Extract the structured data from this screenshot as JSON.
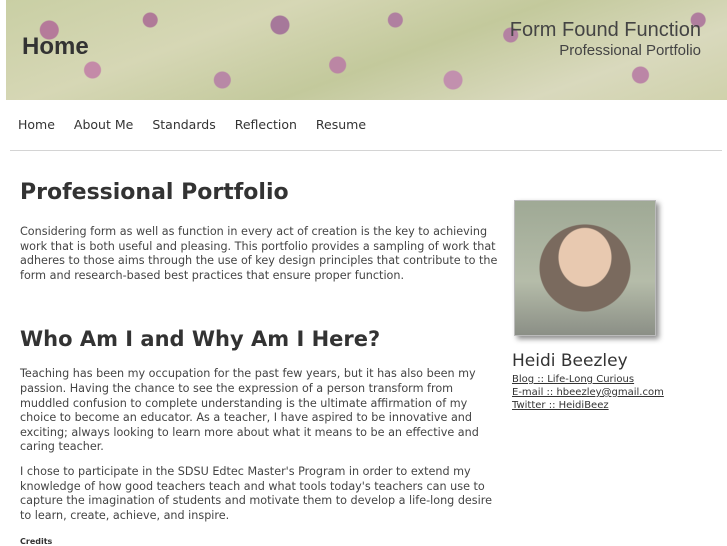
{
  "header": {
    "title": "Home",
    "site_title": "Form Found Function",
    "site_subtitle": "Professional Portfolio"
  },
  "nav": {
    "items": [
      "Home",
      "About Me",
      "Standards",
      "Reflection",
      "Resume"
    ]
  },
  "main": {
    "heading": "Professional Portfolio",
    "intro": "Considering form as well as function in every act of creation is the key to achieving work that is both useful and pleasing. This portfolio provides a sampling of work that adheres to those aims through the use of key design principles that contribute to the form and research-based best practices that ensure proper function.",
    "subheading": "Who Am I and Why Am I Here?",
    "para1": "Teaching has been my occupation for the past few years, but it has also been my passion. Having the chance to see the expression of a person transform from muddled confusion to complete understanding is the ultimate affirmation of my choice to become an educator. As a teacher, I have aspired to be innovative and exciting; always looking to learn more about what it means to be an effective and caring teacher.",
    "para2": "I chose to participate in the SDSU Edtec Master's Program in order to extend my knowledge of how good teachers teach and what tools today's teachers can use to capture the imagination of students and motivate them to develop a life-long desire to learn, create, achieve, and inspire."
  },
  "footer": {
    "credits": "Credits"
  },
  "sidebar": {
    "name": "Heidi Beezley",
    "links": [
      "Blog :: Life-Long Curious",
      "E-mail :: hbeezley@gmail.com",
      "Twitter :: HeidiBeez"
    ]
  }
}
